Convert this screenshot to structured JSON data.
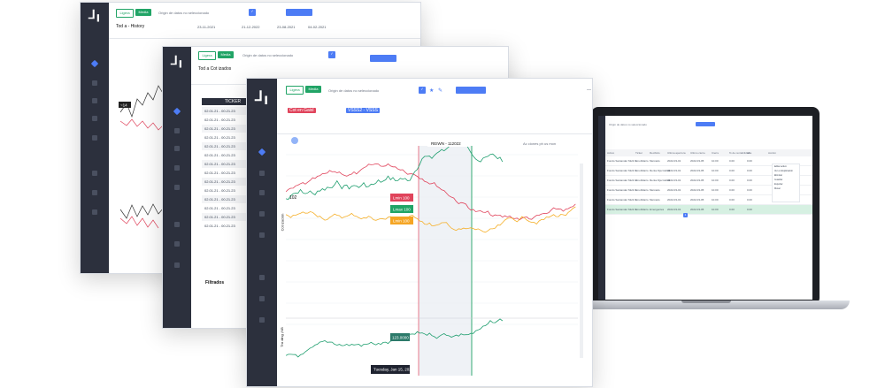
{
  "back_window": {
    "mode_tabs": [
      "Ligera",
      "Media"
    ],
    "url": "Origin de datos no seleccionado",
    "title": "Tod a - History",
    "dates": [
      "23-11-2021",
      "21-12-2022",
      "23-08-2021",
      "04-02-2021"
    ],
    "value_label": "~14"
  },
  "middle_window": {
    "mode_tabs": [
      "Ligera",
      "Media"
    ],
    "url": "Origin de datos no seleccionado",
    "title": "Tod a Cot izados",
    "table_header": "TICKER",
    "rows": [
      "02.01.21 - 00.21.23",
      "02.01.21 - 00.21.23",
      "02.01.21 - 00.21.23",
      "02.01.21 - 00.21.23",
      "02.01.21 - 00.21.23",
      "02.01.21 - 00.21.23",
      "02.01.21 - 00.21.23",
      "02.01.21 - 00.21.23",
      "02.01.21 - 00.21.23",
      "02.01.21 - 00.21.23",
      "02.01.21 - 00.21.23",
      "02.01.21 - 00.21.23",
      "02.01.21 - 00.21.23",
      "02.01.21 - 00.21.23"
    ],
    "footer": "Filtrados"
  },
  "front_window": {
    "mode_tabs": [
      "Ligera",
      "Media"
    ],
    "url": "Origin de datos no seleccionado",
    "chips": [
      "Cot en Gaisl",
      "VSSS2 - VSSS"
    ],
    "top_marker": "REIWN - 112022",
    "top_right_label": "Ac ciones ph us mon",
    "y_label": "Cot ización",
    "y_label2": "Tra ding ¡NB",
    "price_left": "102",
    "tags": [
      {
        "text": "Lmin 100",
        "color": "#e0435b"
      },
      {
        "text": "Lmax 100",
        "color": "#21a466"
      },
      {
        "text": "Lmin 100",
        "color": "#f5a524"
      }
    ],
    "bottom_tag": "123.0000",
    "date_tooltip": "Tuesday, Jan 15, 2021",
    "series_colors": {
      "green": "#1e9e6e",
      "red": "#e0435b",
      "orange": "#f5b02b",
      "line_green": "#21a466"
    }
  },
  "laptop": {
    "url": "Origin de datos no seleccionado",
    "columns": [
      "Activo",
      "Ticker",
      "Recibido",
      "Ultima apertura",
      "Ultimo cierre",
      "Cierre",
      "% de rentabilidad",
      "Alta",
      "Acción"
    ],
    "rows": [
      [
        "Fondo Santander Multi Inmobiliario",
        "1",
        "Mercado",
        "2022-03-01",
        "2022-03-05",
        "10.00",
        "0.00",
        "0.00"
      ],
      [
        "Fondo Santander Multi Inmobiliario",
        "1",
        "Renta Fija Global",
        "2022-03-01",
        "2022-03-05",
        "10.00",
        "0.00",
        "0.00"
      ],
      [
        "Fondo Santander Multi Inmobiliario",
        "2",
        "Renta Fija Global",
        "2022-03-01",
        "2022-03-05",
        "10.00",
        "0.00",
        "0.00"
      ],
      [
        "Fondo Santander Multi Inmobiliario",
        "1",
        "Mercado",
        "2022-03-01",
        "2022-03-05",
        "10.00",
        "0.00",
        "0.00"
      ],
      [
        "Fondo Santander Multi Inmobiliario",
        "1",
        "Mercado",
        "2022-03-01",
        "2022-03-05",
        "10.00",
        "0.00",
        "0.00"
      ],
      [
        "Fondo Santander Multi Inmobiliario",
        "1",
        "Emergentes",
        "2022-03-01",
        "2022-03-05",
        "10.00",
        "0.00",
        "0.00"
      ]
    ],
    "action_button": "Acción",
    "menu": [
      "Editar activo",
      "Ver en Exploración",
      "Eliminar",
      "Guardar",
      "Exportar",
      "Mover"
    ],
    "pagination": "1"
  }
}
